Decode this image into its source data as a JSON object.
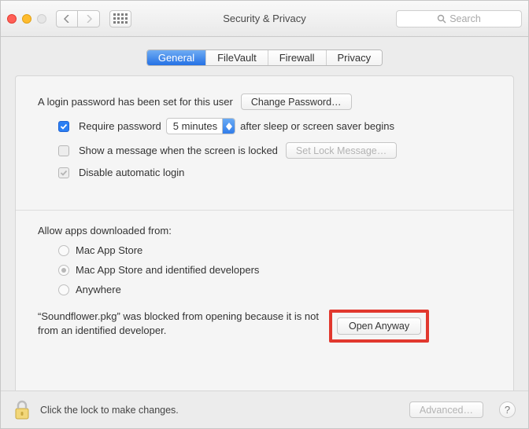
{
  "window": {
    "title": "Security & Privacy",
    "search_placeholder": "Search"
  },
  "tabs": {
    "general": "General",
    "filevault": "FileVault",
    "firewall": "Firewall",
    "privacy": "Privacy"
  },
  "login": {
    "password_set_text": "A login password has been set for this user",
    "change_password_btn": "Change Password…",
    "require_password_label": "Require password",
    "require_password_delay": "5 minutes",
    "after_sleep_text": "after sleep or screen saver begins",
    "show_message_label": "Show a message when the screen is locked",
    "set_lock_message_btn": "Set Lock Message…",
    "disable_auto_login_label": "Disable automatic login"
  },
  "allow_apps": {
    "heading": "Allow apps downloaded from:",
    "opt_appstore": "Mac App Store",
    "opt_identified": "Mac App Store and identified developers",
    "opt_anywhere": "Anywhere",
    "blocked_msg": "“Soundflower.pkg” was blocked from opening because it is not from an identified developer.",
    "open_anyway_btn": "Open Anyway"
  },
  "footer": {
    "lock_text": "Click the lock to make changes.",
    "advanced_btn": "Advanced…"
  }
}
